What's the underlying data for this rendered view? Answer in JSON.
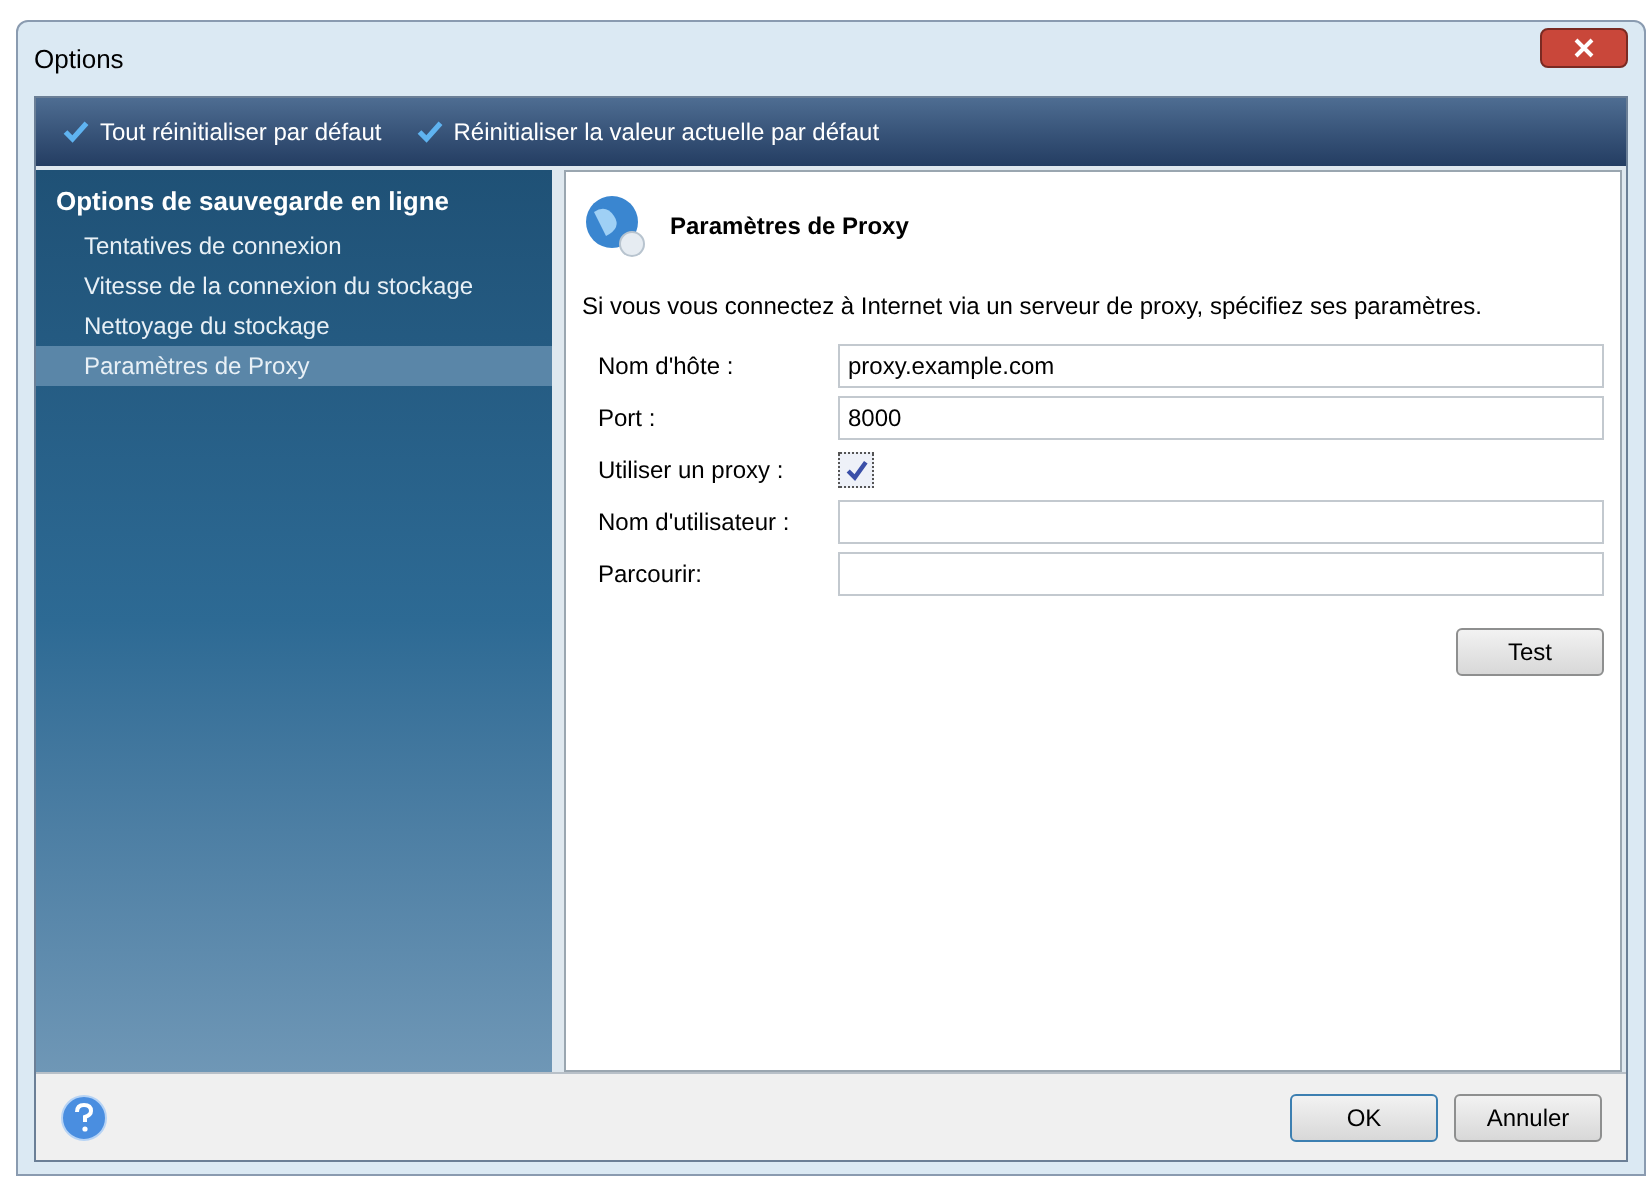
{
  "window": {
    "title": "Options"
  },
  "toolbar": [
    {
      "label": "Tout réinitialiser par défaut"
    },
    {
      "label": "Réinitialiser la valeur actuelle par défaut"
    }
  ],
  "sidebar": {
    "heading": "Options de sauvegarde en ligne",
    "items": [
      {
        "label": "Tentatives de connexion",
        "selected": false
      },
      {
        "label": "Vitesse de la connexion du stockage",
        "selected": false
      },
      {
        "label": "Nettoyage du stockage",
        "selected": false
      },
      {
        "label": "Paramètres de Proxy",
        "selected": true
      }
    ]
  },
  "panel": {
    "title": "Paramètres de Proxy",
    "description": "Si vous vous connectez à Internet via un serveur de proxy, spécifiez ses paramètres.",
    "fields": [
      {
        "kind": "text",
        "label": "Nom d'hôte :",
        "value": "proxy.example.com"
      },
      {
        "kind": "text",
        "label": "Port :",
        "value": "8000"
      },
      {
        "kind": "checkbox",
        "label": "Utiliser un proxy :",
        "checked": true
      },
      {
        "kind": "text",
        "label": "Nom d'utilisateur :"
      },
      {
        "kind": "text",
        "label": "Parcourir:"
      }
    ],
    "test_button": "Test"
  },
  "buttons": [
    "OK",
    "Annuler"
  ]
}
